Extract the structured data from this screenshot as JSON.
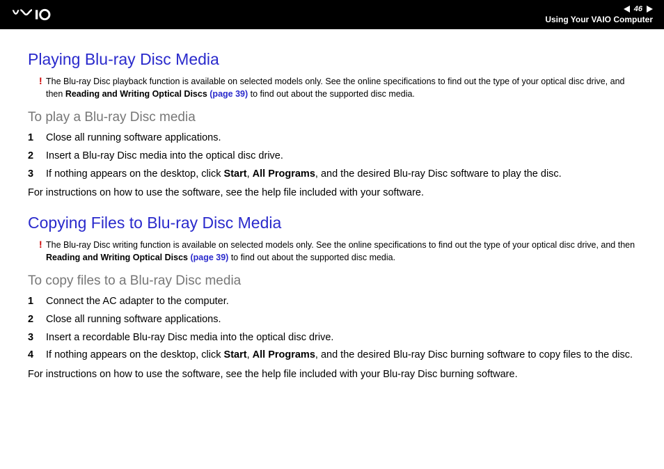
{
  "header": {
    "page_number": "46",
    "section": "Using Your VAIO Computer"
  },
  "sec1": {
    "title": "Playing Blu-ray Disc Media",
    "note_pre": "The Blu-ray Disc playback function is available on selected models only. See the online specifications to find out the type of your optical disc drive, and then ",
    "note_bold": "Reading and Writing Optical Discs ",
    "note_link": "(page 39)",
    "note_post": " to find out about the supported disc media.",
    "subhead": "To play a Blu-ray Disc media",
    "steps": [
      "Close all running software applications.",
      "Insert a Blu-ray Disc media into the optical disc drive."
    ],
    "step3_pre": "If nothing appears on the desktop, click ",
    "step3_b1": "Start",
    "step3_mid": ", ",
    "step3_b2": "All Programs",
    "step3_post": ", and the desired Blu-ray Disc software to play the disc.",
    "after": "For instructions on how to use the software, see the help file included with your software."
  },
  "sec2": {
    "title": "Copying Files to Blu-ray Disc Media",
    "note_pre": "The Blu-ray Disc writing function is available on selected models only. See the online specifications to find out the type of your optical disc drive, and then ",
    "note_bold": "Reading and Writing Optical Discs ",
    "note_link": "(page 39)",
    "note_post": " to find out about the supported disc media.",
    "subhead": "To copy files to a Blu-ray Disc media",
    "steps": [
      "Connect the AC adapter to the computer.",
      "Close all running software applications.",
      "Insert a recordable Blu-ray Disc media into the optical disc drive."
    ],
    "step4_pre": "If nothing appears on the desktop, click ",
    "step4_b1": "Start",
    "step4_mid": ", ",
    "step4_b2": "All Programs",
    "step4_post": ", and the desired Blu-ray Disc burning software to copy files to the disc.",
    "after": "For instructions on how to use the software, see the help file included with your Blu-ray Disc burning software."
  }
}
